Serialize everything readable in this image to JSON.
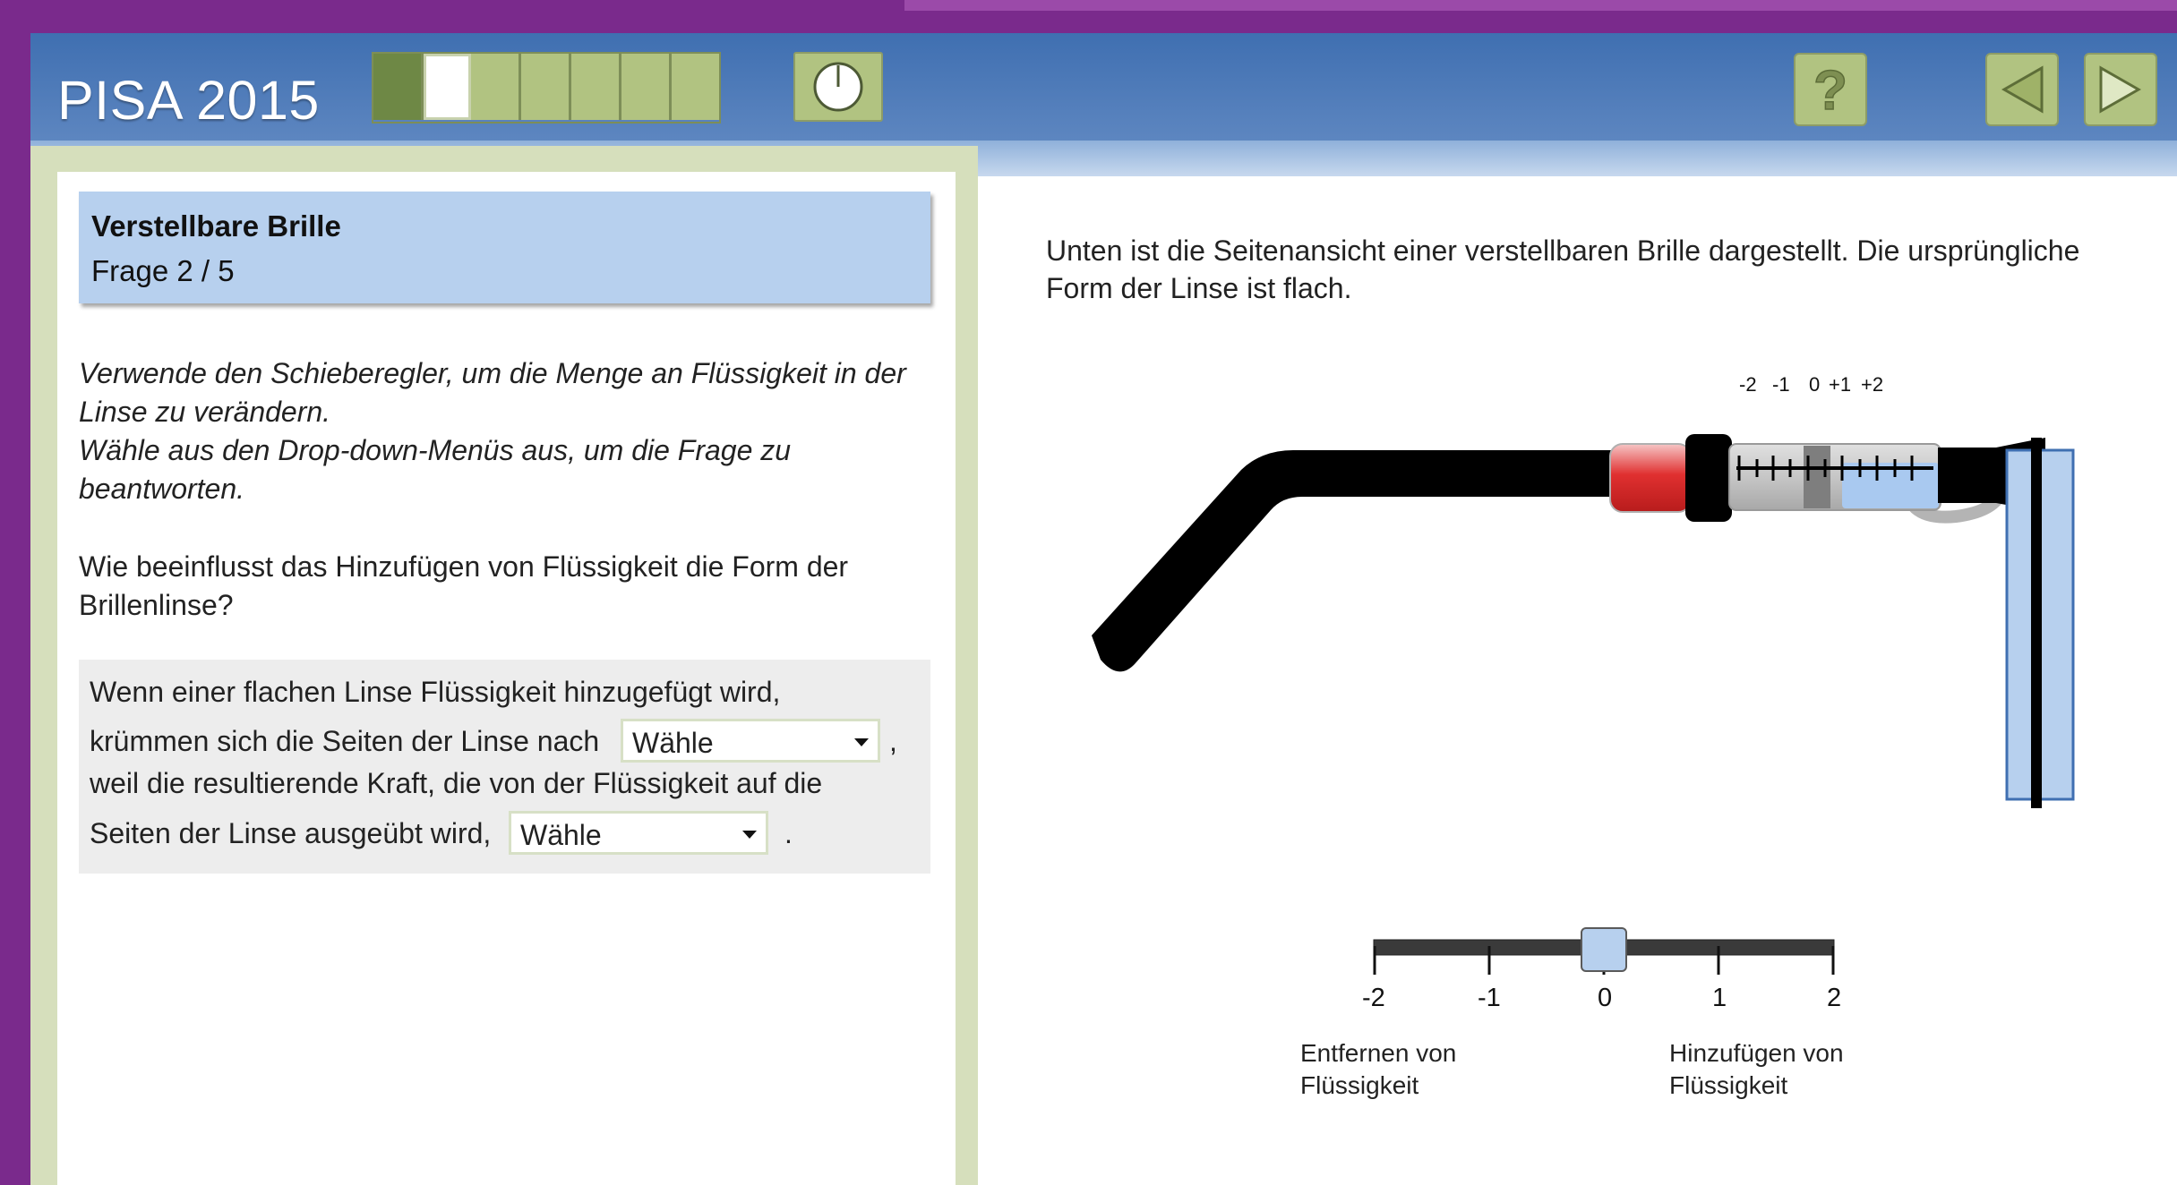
{
  "header": {
    "app_title": "PISA 2015",
    "progress_segments": [
      {
        "state": "done"
      },
      {
        "state": "current"
      },
      {
        "state": "pending"
      },
      {
        "state": "pending"
      },
      {
        "state": "pending"
      },
      {
        "state": "pending"
      },
      {
        "state": "pending"
      }
    ],
    "timer_icon": "clock-icon",
    "help_icon": "question-mark-icon",
    "help_label": "?",
    "prev_icon": "arrow-left-icon",
    "next_icon": "arrow-right-icon",
    "colors": {
      "header_blue": "#4a78b8",
      "button_green": "#b1c381",
      "progress_done": "#6e8845"
    }
  },
  "unit": {
    "title": "Verstellbare Brille",
    "question_number": "Frage 2 / 5"
  },
  "instructions": [
    "Verwende den Schieberegler, um die Menge an Flüssigkeit in der Linse zu verändern.",
    "Wähle aus den Drop-down-Menüs aus, um die Frage zu beantworten."
  ],
  "question": "Wie beeinflusst das Hinzufügen von Flüssigkeit die Form der Brillenlinse?",
  "answer": {
    "line1": "Wenn einer flachen Linse Flüssigkeit hinzugefügt wird,",
    "line2": "krümmen sich die Seiten der Linse nach",
    "dropdown1_value": "Wähle",
    "comma": ",",
    "line3": "weil die resultierende Kraft, die von der Flüssigkeit auf die",
    "line4": "Seiten der Linse ausgeübt wird,",
    "dropdown2_value": "Wähle",
    "period": "."
  },
  "stimulus": {
    "description": "Unten ist die Seitenansicht einer verstellbaren Brille dargestellt. Die ursprüngliche Form der Linse ist flach.",
    "syringe_scale": [
      "-2",
      "-1",
      "0",
      "+1",
      "+2"
    ]
  },
  "slider": {
    "min": -2,
    "max": 2,
    "value": 0,
    "ticks": [
      "-2",
      "-1",
      "0",
      "1",
      "2"
    ],
    "left_caption": [
      "Entfernen von",
      "Flüssigkeit"
    ],
    "right_caption": [
      "Hinzufügen von",
      "Flüssigkeit"
    ],
    "handle_color": "#b7d0ee"
  }
}
